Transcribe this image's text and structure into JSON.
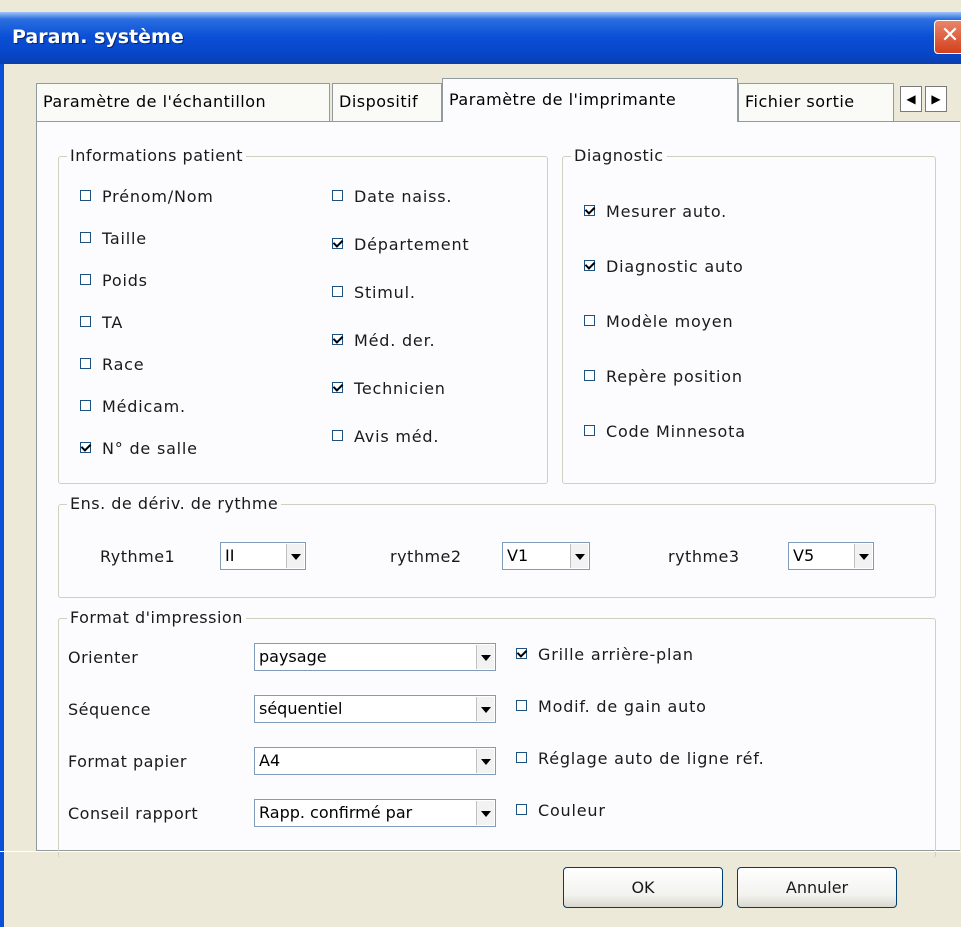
{
  "window": {
    "title": "Param. système",
    "close_glyph": "✕"
  },
  "tabs": [
    {
      "label": "Paramètre de l'échantillon"
    },
    {
      "label": "Dispositif"
    },
    {
      "label": "Paramètre de l'imprimante"
    },
    {
      "label": "Fichier sortie"
    }
  ],
  "tab_scroll": {
    "left": "◀",
    "right": "▶"
  },
  "patient": {
    "legend": "Informations patient",
    "col1": [
      {
        "label": "Prénom/Nom",
        "checked": false
      },
      {
        "label": "Taille",
        "checked": false
      },
      {
        "label": "Poids",
        "checked": false
      },
      {
        "label": "TA",
        "checked": false
      },
      {
        "label": "Race",
        "checked": false
      },
      {
        "label": "Médicam.",
        "checked": false
      },
      {
        "label": "N° de salle",
        "checked": true
      }
    ],
    "col2": [
      {
        "label": "Date naiss.",
        "checked": false
      },
      {
        "label": "Département",
        "checked": true
      },
      {
        "label": "Stimul.",
        "checked": false
      },
      {
        "label": "Méd. der.",
        "checked": true
      },
      {
        "label": "Technicien",
        "checked": true
      },
      {
        "label": "Avis méd.",
        "checked": false
      }
    ]
  },
  "diagnostic": {
    "legend": "Diagnostic",
    "items": [
      {
        "label": "Mesurer auto.",
        "checked": true
      },
      {
        "label": "Diagnostic auto",
        "checked": true
      },
      {
        "label": "Modèle moyen",
        "checked": false
      },
      {
        "label": "Repère position",
        "checked": false
      },
      {
        "label": "Code Minnesota",
        "checked": false
      }
    ]
  },
  "rhythm": {
    "legend": "Ens. de dériv. de rythme",
    "items": [
      {
        "label": "Rythme1",
        "value": "II"
      },
      {
        "label": "rythme2",
        "value": "V1"
      },
      {
        "label": "rythme3",
        "value": "V5"
      }
    ]
  },
  "print": {
    "legend": "Format d'impression",
    "fields": [
      {
        "label": "Orienter",
        "value": "paysage"
      },
      {
        "label": "Séquence",
        "value": "séquentiel"
      },
      {
        "label": "Format papier",
        "value": "A4"
      },
      {
        "label": "Conseil rapport",
        "value": "Rapp. confirmé par"
      }
    ],
    "options": [
      {
        "label": "Grille arrière-plan",
        "checked": true
      },
      {
        "label": "Modif. de gain auto",
        "checked": false
      },
      {
        "label": "Réglage auto de ligne réf.",
        "checked": false
      },
      {
        "label": "Couleur",
        "checked": false
      }
    ]
  },
  "buttons": {
    "ok": "OK",
    "cancel": "Annuler"
  }
}
